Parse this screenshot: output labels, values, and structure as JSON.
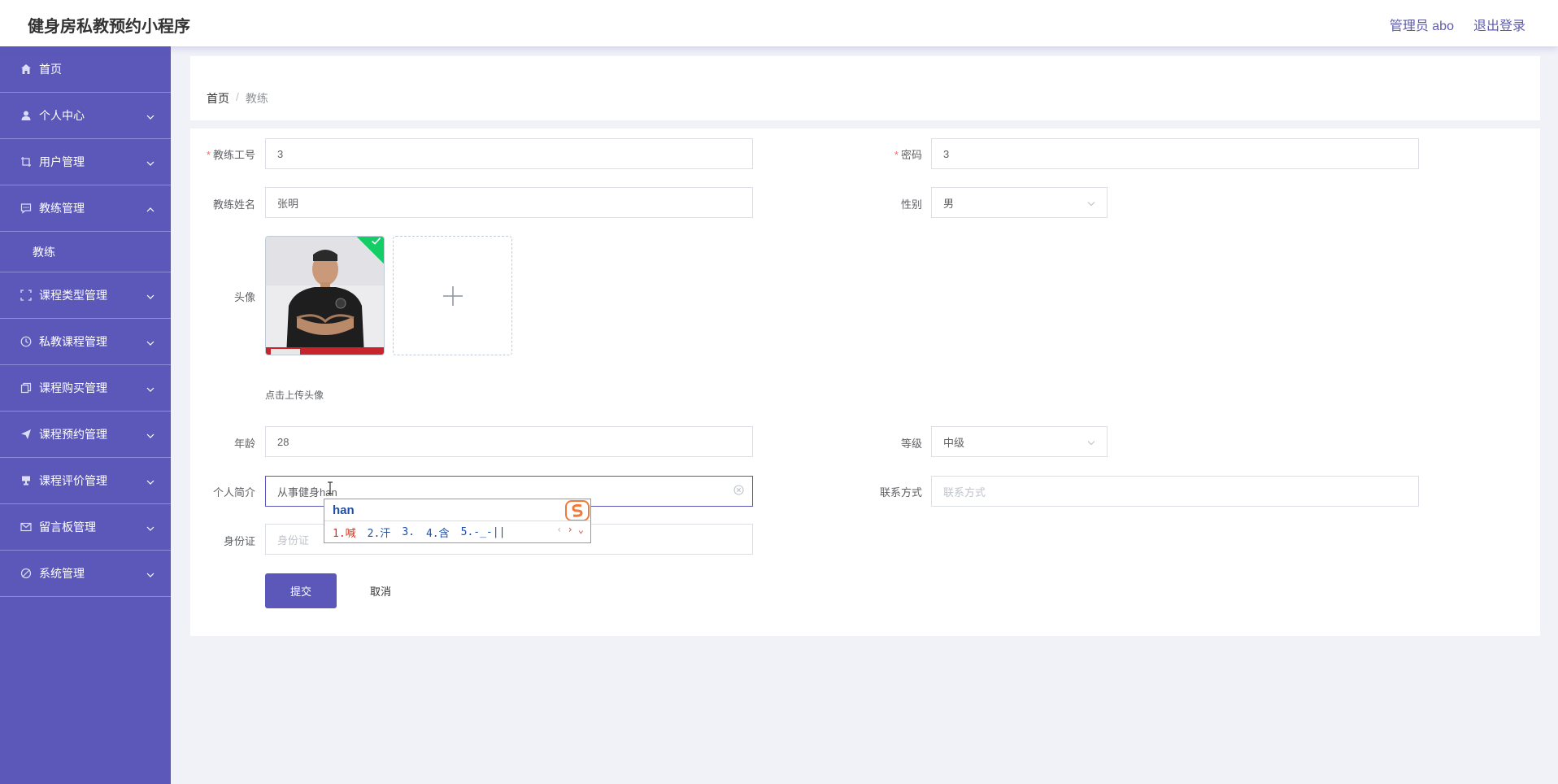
{
  "app": {
    "title": "健身房私教预约小程序",
    "admin_label": "管理员 abo",
    "logout": "退出登录"
  },
  "sidebar": {
    "items": [
      {
        "label": "首页",
        "icon": "home-icon"
      },
      {
        "label": "个人中心",
        "icon": "user-icon"
      },
      {
        "label": "用户管理",
        "icon": "crop-icon"
      },
      {
        "label": "教练管理",
        "icon": "chat-icon",
        "expanded": true,
        "children": [
          {
            "label": "教练"
          }
        ]
      },
      {
        "label": "课程类型管理",
        "icon": "fullscreen-icon"
      },
      {
        "label": "私教课程管理",
        "icon": "clock-icon"
      },
      {
        "label": "课程购买管理",
        "icon": "copy-icon"
      },
      {
        "label": "课程预约管理",
        "icon": "send-icon"
      },
      {
        "label": "课程评价管理",
        "icon": "trophy-icon"
      },
      {
        "label": "留言板管理",
        "icon": "message-icon"
      },
      {
        "label": "系统管理",
        "icon": "settings-icon"
      }
    ]
  },
  "breadcrumb": {
    "home": "首页",
    "separator": "/",
    "current": "教练"
  },
  "form": {
    "coach_id": {
      "label": "教练工号",
      "value": "3"
    },
    "password": {
      "label": "密码",
      "value": "3"
    },
    "coach_name": {
      "label": "教练姓名",
      "value": "张明"
    },
    "gender": {
      "label": "性别",
      "value": "男"
    },
    "avatar": {
      "label": "头像",
      "hint": "点击上传头像"
    },
    "age": {
      "label": "年龄",
      "value": "28"
    },
    "level": {
      "label": "等级",
      "value": "中级"
    },
    "bio": {
      "label": "个人简介",
      "value": "从事健身han"
    },
    "contact": {
      "label": "联系方式",
      "placeholder": "联系方式"
    },
    "id_card": {
      "label": "身份证",
      "placeholder": "身份证"
    },
    "submit": "提交",
    "cancel": "取消"
  },
  "ime": {
    "composition": "han",
    "candidates": [
      "1.喊",
      "2.汗",
      "3.",
      "4.含",
      "5.-_-||"
    ]
  },
  "colors": {
    "primary": "#5b58ba",
    "success": "#13ce66",
    "required": "#f56c6c"
  }
}
